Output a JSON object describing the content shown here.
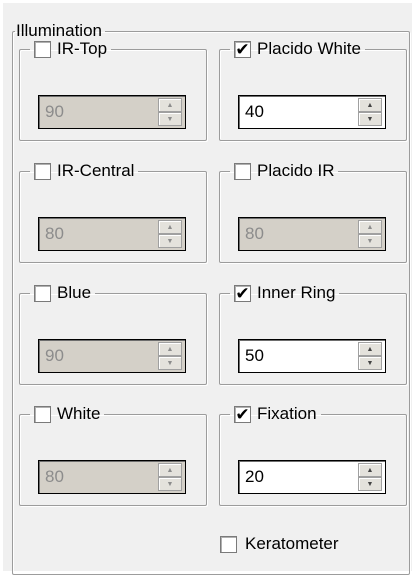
{
  "illumination": {
    "title": "Illumination",
    "groups": [
      {
        "label": "IR-Top",
        "checked": false,
        "value": "90",
        "enabled": false
      },
      {
        "label": "Placido White",
        "checked": true,
        "value": "40",
        "enabled": true
      },
      {
        "label": "IR-Central",
        "checked": false,
        "value": "80",
        "enabled": false
      },
      {
        "label": "Placido IR",
        "checked": false,
        "value": "80",
        "enabled": false
      },
      {
        "label": "Blue",
        "checked": false,
        "value": "90",
        "enabled": false
      },
      {
        "label": "Inner Ring",
        "checked": true,
        "value": "50",
        "enabled": true
      },
      {
        "label": "White",
        "checked": false,
        "value": "80",
        "enabled": false
      },
      {
        "label": "Fixation",
        "checked": true,
        "value": "20",
        "enabled": true
      }
    ],
    "keratometer": {
      "label": "Keratometer",
      "checked": false
    },
    "check_glyph": "✔",
    "spin_up_glyph": "▲",
    "spin_down_glyph": "▼"
  }
}
